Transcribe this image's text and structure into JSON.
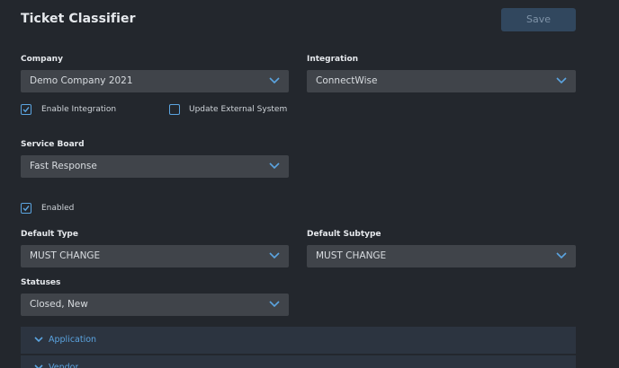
{
  "header": {
    "title": "Ticket Classifier",
    "save_label": "Save"
  },
  "form": {
    "company": {
      "label": "Company",
      "value": "Demo Company 2021"
    },
    "integration": {
      "label": "Integration",
      "value": "ConnectWise"
    },
    "enable_integration": {
      "label": "Enable Integration",
      "checked": true
    },
    "update_external": {
      "label": "Update External System",
      "checked": false
    },
    "service_board": {
      "label": "Service Board",
      "value": "Fast Response"
    },
    "enabled": {
      "label": "Enabled",
      "checked": true
    },
    "default_type": {
      "label": "Default Type",
      "value": "MUST CHANGE"
    },
    "default_subtype": {
      "label": "Default Subtype",
      "value": "MUST CHANGE"
    },
    "statuses": {
      "label": "Statuses",
      "value": "Closed, New"
    }
  },
  "sections": [
    {
      "label": "Application",
      "expanded": true
    },
    {
      "label": "Vendor",
      "expanded": true
    }
  ],
  "colors": {
    "background": "#23272d",
    "select_bg": "#40444a",
    "accent": "#5ba4e0",
    "save_button_bg": "#31475e",
    "accordion_bg": "#2c3440"
  }
}
